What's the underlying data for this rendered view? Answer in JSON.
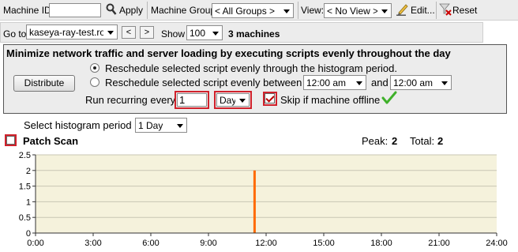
{
  "toolbar": {
    "machine_id_label": "Machine ID:",
    "machine_id_value": "",
    "apply_label": "Apply",
    "machine_group_label": "Machine Group:",
    "machine_group_value": "< All Groups >",
    "view_label": "View:",
    "view_value": "< No View >",
    "edit_label": "Edit...",
    "reset_label": "Reset"
  },
  "nav": {
    "goto_label": "Go to:",
    "goto_value": "kaseya-ray-test.roo",
    "prev_glyph": "<",
    "next_glyph": ">",
    "show_label": "Show",
    "show_value": "100",
    "machine_count": "3 machines"
  },
  "panel": {
    "heading": "Minimize network traffic and server loading by executing scripts evenly throughout the day",
    "distribute_label": "Distribute",
    "option1_label": "Reschedule selected script evenly through the histogram period.",
    "option2_label": "Reschedule selected script evenly between",
    "start_time": "12:00 am",
    "and_label": "and",
    "end_time": "12:00 am",
    "run_recurring_label": "Run recurring every",
    "recurring_value": "1",
    "recurring_unit": "Day",
    "skip_label": "Skip if machine offline"
  },
  "histogram": {
    "period_label": "Select histogram period",
    "period_value": "1 Day",
    "script_name": "Patch Scan",
    "peak_label": "Peak:",
    "peak_value": "2",
    "total_label": "Total:",
    "total_value": "2"
  },
  "colors": {
    "plot_bg": "#f5f2dc",
    "bar": "#ff6a00",
    "grid": "#c8c6b4"
  },
  "chart_data": {
    "type": "bar",
    "x": [
      11.4
    ],
    "values": [
      2
    ],
    "xlim": [
      0,
      24
    ],
    "ylim": [
      0,
      2.5
    ],
    "xticks": [
      "0:00",
      "3:00",
      "6:00",
      "9:00",
      "12:00",
      "15:00",
      "18:00",
      "21:00",
      "24:00"
    ],
    "yticks": [
      "0",
      "0.5",
      "1",
      "1.5",
      "2",
      "2.5"
    ],
    "grid": true
  }
}
